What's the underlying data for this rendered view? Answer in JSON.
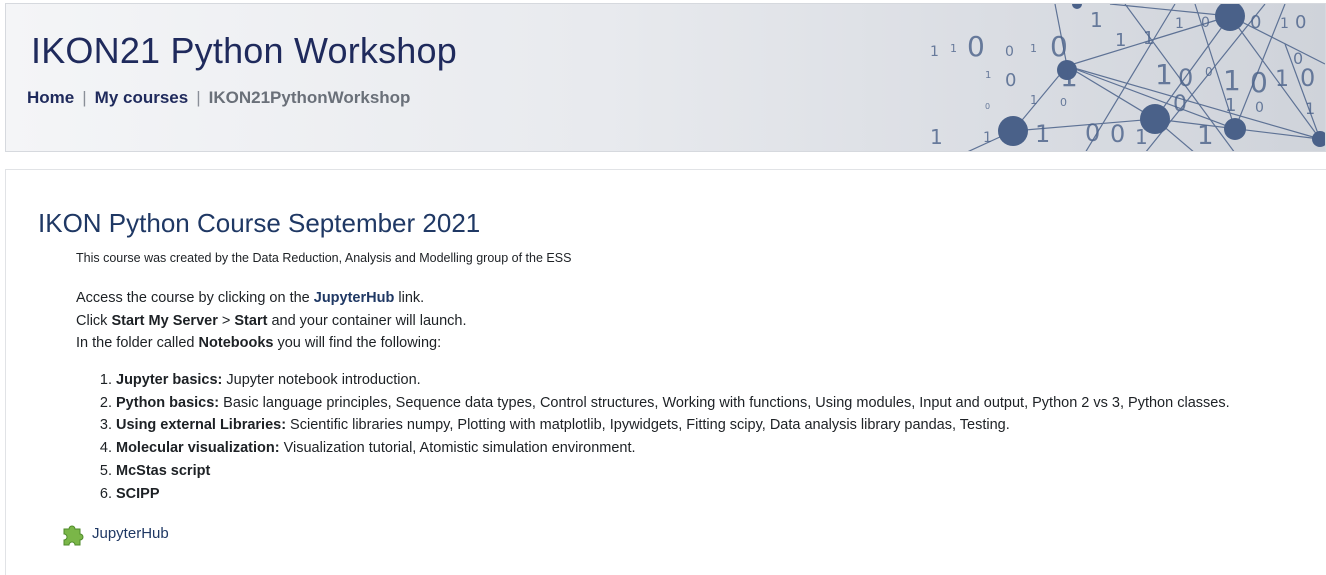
{
  "header": {
    "site_title": "IKON21 Python Workshop",
    "breadcrumb": {
      "home": "Home",
      "my_courses": "My courses",
      "current": "IKON21PythonWorkshop",
      "separator": "|"
    }
  },
  "course": {
    "title": "IKON Python Course September 2021",
    "summary": "This course was created by the Data Reduction, Analysis and Modelling group of the ESS",
    "access_lines": {
      "line1_pre": "Access the course by clicking on the ",
      "line1_link": "JupyterHub",
      "line1_post": " link.",
      "line2_pre": "Click ",
      "line2_b1": "Start My Server",
      "line2_mid": " > ",
      "line2_b2": "Start",
      "line2_post": " and your container will launch.",
      "line3_pre": "In the folder called ",
      "line3_b": "Notebooks",
      "line3_post": " you will find the following:"
    },
    "topics": [
      {
        "title": "Jupyter basics:",
        "desc": " Jupyter notebook introduction."
      },
      {
        "title": "Python basics:",
        "desc": "  Basic language principles,  Sequence data types,  Control structures,  Working with functions,  Using modules,  Input and output,  Python 2 vs 3,  Python classes."
      },
      {
        "title": "Using external Libraries:",
        "desc": "  Scientific libraries numpy,  Plotting with matplotlib,  Ipywidgets,  Fitting scipy,  Data analysis library pandas,  Testing."
      },
      {
        "title": "Molecular visualization:",
        "desc": "  Visualization tutorial,  Atomistic simulation environment."
      },
      {
        "title": "McStas script",
        "desc": ""
      },
      {
        "title": "SCIPP",
        "desc": ""
      }
    ],
    "jupyterhub_link": "JupyterHub"
  },
  "icons": {
    "activity_icon": "puzzle-piece-icon",
    "activity_icon_color": "#7ab648"
  },
  "colors": {
    "title": "#1f2a5c",
    "link": "#1f3864",
    "header_art": "#4a6189"
  }
}
